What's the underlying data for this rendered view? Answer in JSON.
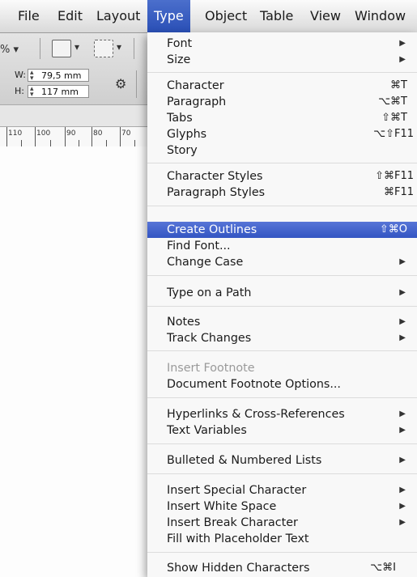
{
  "menubar": {
    "items": [
      {
        "label": "File",
        "active": false
      },
      {
        "label": "Edit",
        "active": false
      },
      {
        "label": "Layout",
        "active": false
      },
      {
        "label": "Type",
        "active": true
      },
      {
        "label": "Object",
        "active": false
      },
      {
        "label": "Table",
        "active": false
      },
      {
        "label": "View",
        "active": false
      },
      {
        "label": "Window",
        "active": false
      }
    ]
  },
  "toolbar": {
    "zoom_partial": "% ▾",
    "width_label": "W:",
    "width_value": "79,5 mm",
    "height_label": "H:",
    "height_value": "117 mm"
  },
  "ruler": {
    "labels": [
      "110",
      "100",
      "90",
      "80",
      "70"
    ]
  },
  "type_menu": {
    "font": "Font",
    "size": "Size",
    "character": "Character",
    "character_sc": "⌘T",
    "paragraph": "Paragraph",
    "paragraph_sc": "⌥⌘T",
    "tabs": "Tabs",
    "tabs_sc": "⇧⌘T",
    "glyphs": "Glyphs",
    "glyphs_sc": "⌥⇧F11",
    "story": "Story",
    "character_styles": "Character Styles",
    "character_styles_sc": "⇧⌘F11",
    "paragraph_styles": "Paragraph Styles",
    "paragraph_styles_sc": "⌘F11",
    "create_outlines": "Create Outlines",
    "create_outlines_sc": "⇧⌘O",
    "find_font": "Find Font...",
    "change_case": "Change Case",
    "type_on_path": "Type on a Path",
    "notes": "Notes",
    "track_changes": "Track Changes",
    "insert_footnote": "Insert Footnote",
    "document_footnote_options": "Document Footnote Options...",
    "hyperlinks": "Hyperlinks & Cross-References",
    "text_variables": "Text Variables",
    "bulleted_lists": "Bulleted & Numbered Lists",
    "insert_special_character": "Insert Special Character",
    "insert_white_space": "Insert White Space",
    "insert_break_character": "Insert Break Character",
    "fill_placeholder": "Fill with Placeholder Text",
    "show_hidden": "Show Hidden Characters",
    "show_hidden_sc": "⌥⌘I"
  },
  "colors": {
    "menu_highlight": "#3a5bc6",
    "menubar_bg": "#ececec"
  }
}
